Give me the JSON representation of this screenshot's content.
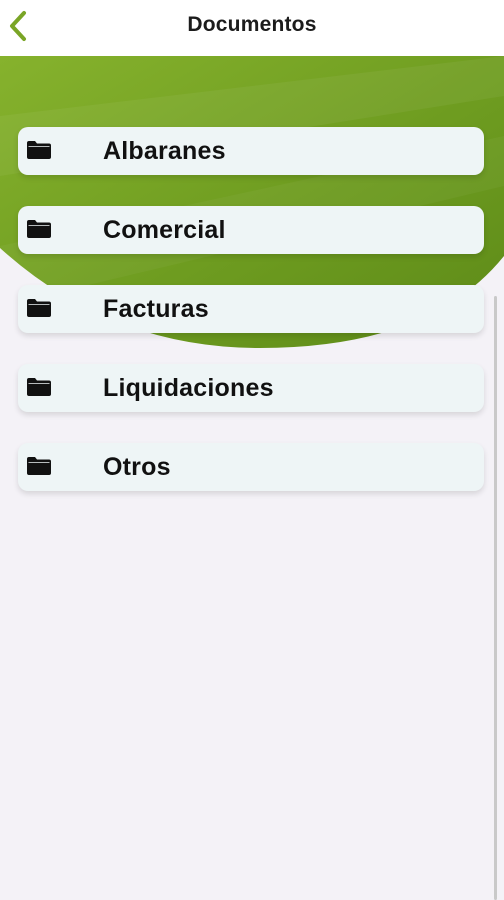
{
  "header": {
    "title": "Documentos",
    "back_icon": "chevron-left-icon",
    "accent_color": "#7aa526"
  },
  "folders": [
    {
      "label": "Albaranes",
      "icon": "folder-icon"
    },
    {
      "label": "Comercial",
      "icon": "folder-icon"
    },
    {
      "label": "Facturas",
      "icon": "folder-icon"
    },
    {
      "label": "Liquidaciones",
      "icon": "folder-icon"
    },
    {
      "label": "Otros",
      "icon": "folder-icon"
    }
  ],
  "colors": {
    "hero_green_light": "#86b22d",
    "hero_green_dark": "#5d8a18",
    "card_bg": "#eef5f6",
    "page_bg": "#f4f2f7"
  }
}
